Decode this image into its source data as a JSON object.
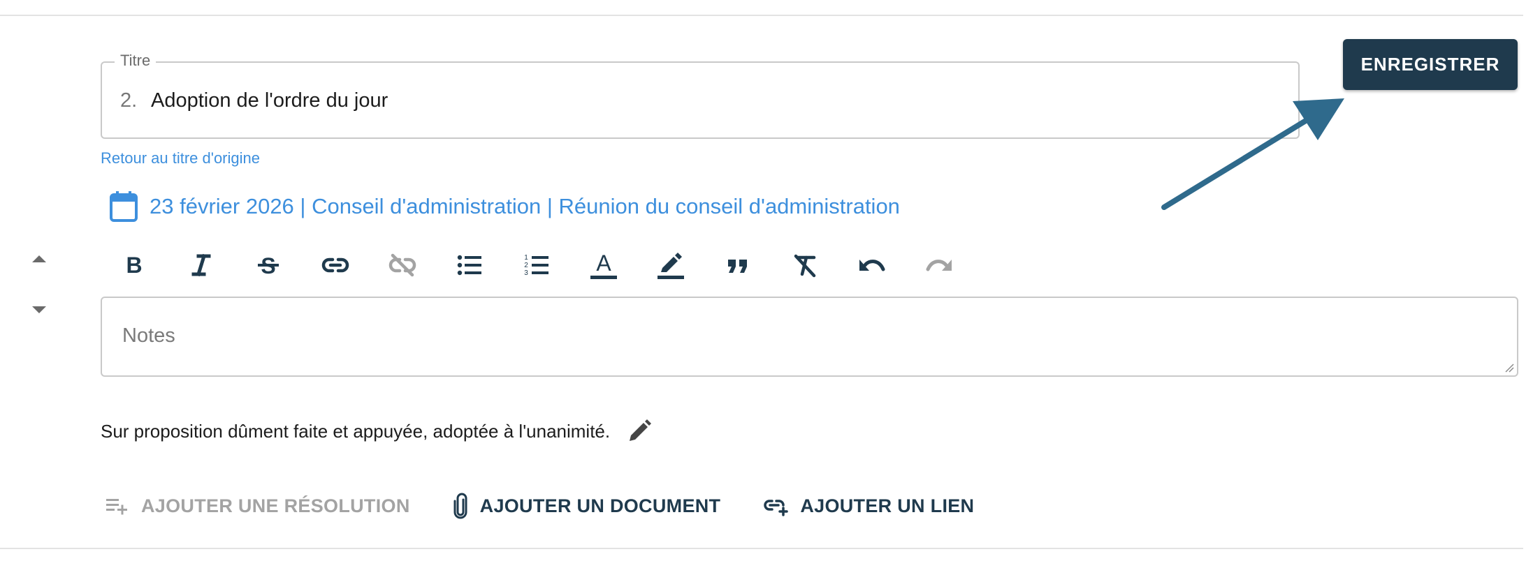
{
  "title_field": {
    "legend": "Titre",
    "number": "2.",
    "value": "Adoption de l'ordre du jour"
  },
  "back_link": "Retour au titre d'origine",
  "meeting_info": "23 février 2026 | Conseil d'administration | Réunion du conseil d'administration",
  "toolbar": [
    {
      "name": "bold",
      "icon": "bold-icon",
      "enabled": true
    },
    {
      "name": "italic",
      "icon": "italic-icon",
      "enabled": true
    },
    {
      "name": "strikethrough",
      "icon": "strikethrough-icon",
      "enabled": true
    },
    {
      "name": "link",
      "icon": "link-icon",
      "enabled": true
    },
    {
      "name": "unlink",
      "icon": "unlink-icon",
      "enabled": false
    },
    {
      "name": "bulleted-list",
      "icon": "bulleted-list-icon",
      "enabled": true
    },
    {
      "name": "numbered-list",
      "icon": "numbered-list-icon",
      "enabled": true
    },
    {
      "name": "text-color",
      "icon": "text-color-icon",
      "enabled": true
    },
    {
      "name": "highlight",
      "icon": "highlight-icon",
      "enabled": true
    },
    {
      "name": "quote",
      "icon": "quote-icon",
      "enabled": true
    },
    {
      "name": "clear-format",
      "icon": "clear-format-icon",
      "enabled": true
    },
    {
      "name": "undo",
      "icon": "undo-icon",
      "enabled": true
    },
    {
      "name": "redo",
      "icon": "redo-icon",
      "enabled": false
    }
  ],
  "notes": {
    "placeholder": "Notes",
    "value": ""
  },
  "resolution_text": "Sur proposition dûment faite et appuyée, adoptée à l'unanimité.",
  "actions": {
    "add_resolution": "AJOUTER UNE RÉSOLUTION",
    "add_document": "AJOUTER UN DOCUMENT",
    "add_link": "AJOUTER UN LIEN"
  },
  "save_button": "ENREGISTRER",
  "colors": {
    "primary": "#1f3a4d",
    "link": "#3d8fdd",
    "annotation_arrow": "#2f6a8c",
    "disabled": "#a3a3a3"
  }
}
